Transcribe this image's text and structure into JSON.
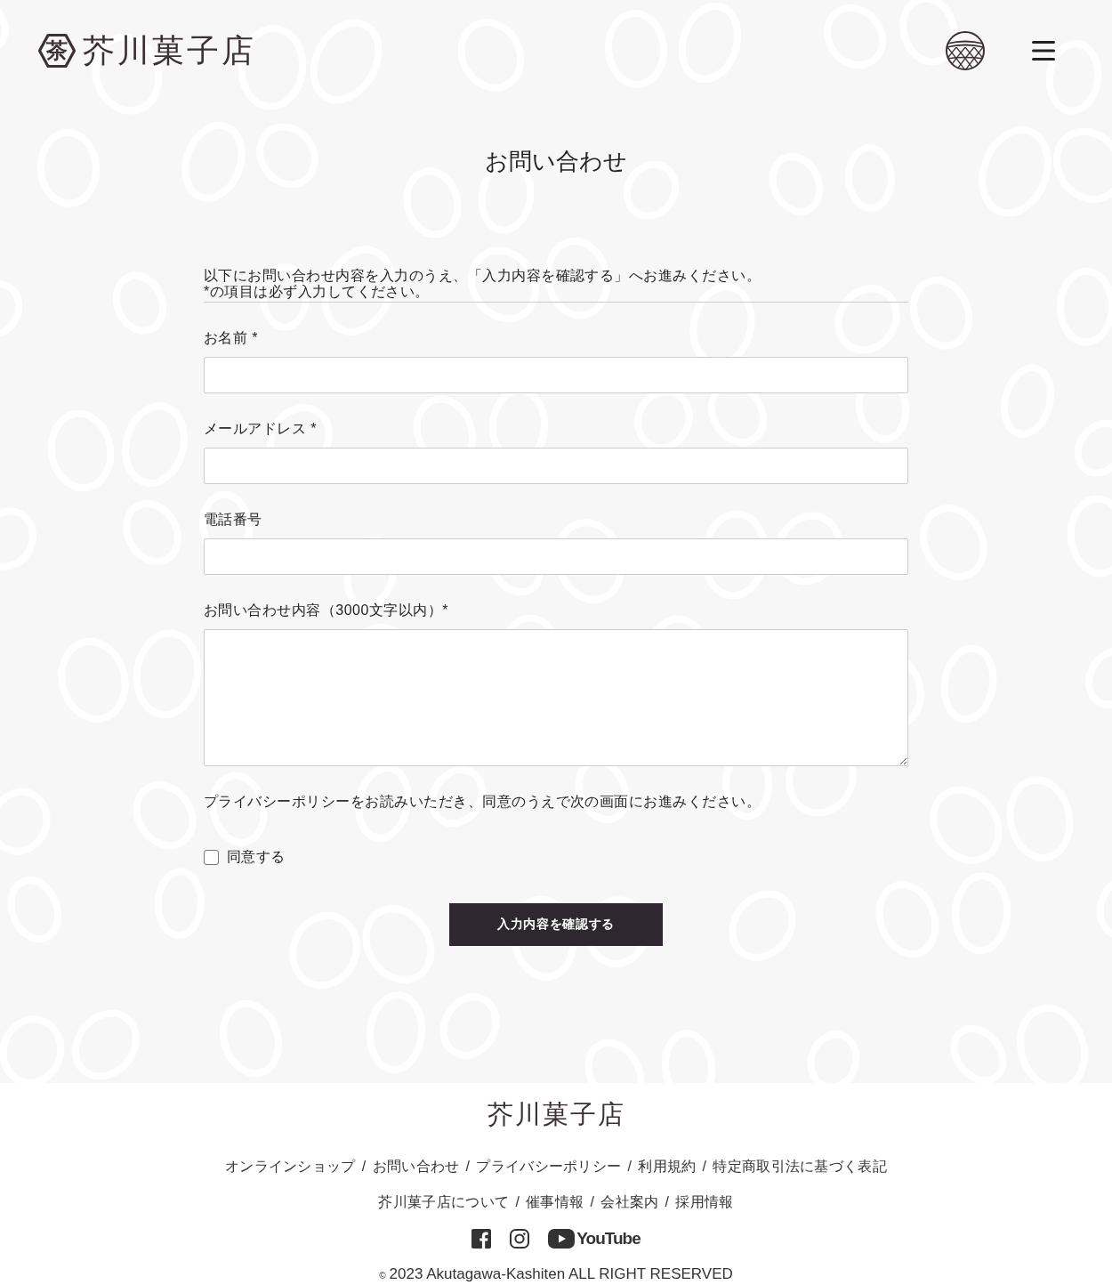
{
  "header": {
    "logo": {
      "mark": "茶",
      "name": "芥川菓子店"
    }
  },
  "page": {
    "title": "お問い合わせ"
  },
  "form": {
    "intro": [
      "以下にお問い合わせ内容を入力のうえ、「入力内容を確認する」へお進みください。",
      "*の項目は必ず入力してください。"
    ],
    "fields": [
      {
        "kind": "input",
        "label": "お名前 *"
      },
      {
        "kind": "input",
        "label": "メールアドレス *"
      },
      {
        "kind": "input",
        "label": "電話番号"
      },
      {
        "kind": "textarea",
        "label": "お問い合わせ内容（3000文字以内）*"
      }
    ],
    "privacy_note": "プライバシーポリシーをお読みいただき、同意のうえで次の画面にお進みください。",
    "consent": {
      "label": "同意する",
      "checked": false
    },
    "submit": {
      "label": "入力内容を確認する"
    }
  },
  "footer": {
    "logo": "芥川菓子店",
    "link_rows": [
      [
        {
          "label": "オンラインショップ",
          "separator": "/"
        },
        {
          "label": "お問い合わせ",
          "separator": "/"
        },
        {
          "label": "プライバシーポリシー",
          "separator": "/"
        },
        {
          "label": "利用規約",
          "separator": "/"
        },
        {
          "label": "特定商取引法に基づく表記"
        }
      ],
      [
        {
          "label": "芥川菓子店について",
          "separator": "/"
        },
        {
          "label": "催事情報",
          "separator": "/"
        },
        {
          "label": "会社案内",
          "separator": "/"
        },
        {
          "label": "採用情報"
        }
      ]
    ],
    "social": [
      {
        "kind": "facebook"
      },
      {
        "kind": "instagram"
      },
      {
        "kind": "youtube",
        "label": "YouTube"
      }
    ],
    "copyright": {
      "symbol": "©",
      "text": "2023 Akutagawa-Kashiten ALL RIGHT RESERVED"
    }
  }
}
